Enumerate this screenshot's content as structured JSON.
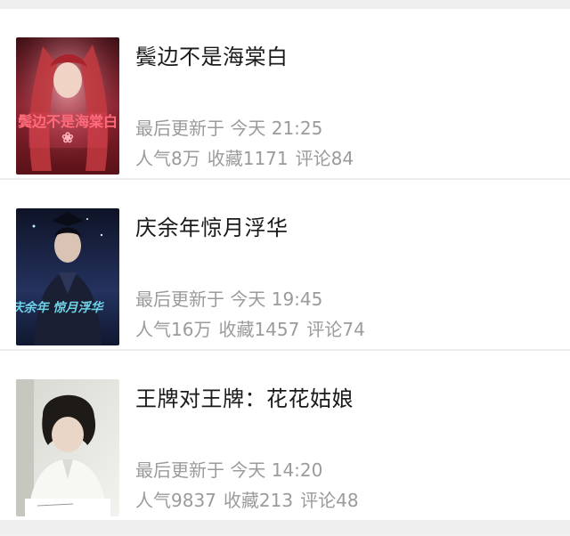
{
  "books": [
    {
      "title": "鬓边不是海棠白",
      "update_text": "最后更新于 今天 21:25",
      "popularity": "人气8万",
      "favorites": "收藏1171",
      "comments": "评论84",
      "cover_icon": "book-cover-red-haired-figure",
      "cover_text": "鬓边不是海棠白",
      "colors": {
        "bg": "#7a1e22",
        "accent": "#e0485a",
        "glow": "#f3a6b0"
      }
    },
    {
      "title": "庆余年惊月浮华",
      "update_text": "最后更新于 今天 19:45",
      "popularity": "人气16万",
      "favorites": "收藏1457",
      "comments": "评论74",
      "cover_icon": "book-cover-costume-portrait",
      "cover_text": "庆余年 惊月浮华",
      "colors": {
        "bg": "#1b2340",
        "accent": "#6fd3e8",
        "glow": "#b9efff"
      }
    },
    {
      "title": "王牌对王牌：花花姑娘",
      "update_text": "最后更新于 今天 14:20",
      "popularity": "人气9837",
      "favorites": "收藏213",
      "comments": "评论48",
      "cover_icon": "book-cover-student-portrait",
      "cover_text": "",
      "colors": {
        "bg": "#e6e6e2",
        "accent": "#2a2420",
        "glow": "#ffffff"
      }
    }
  ]
}
